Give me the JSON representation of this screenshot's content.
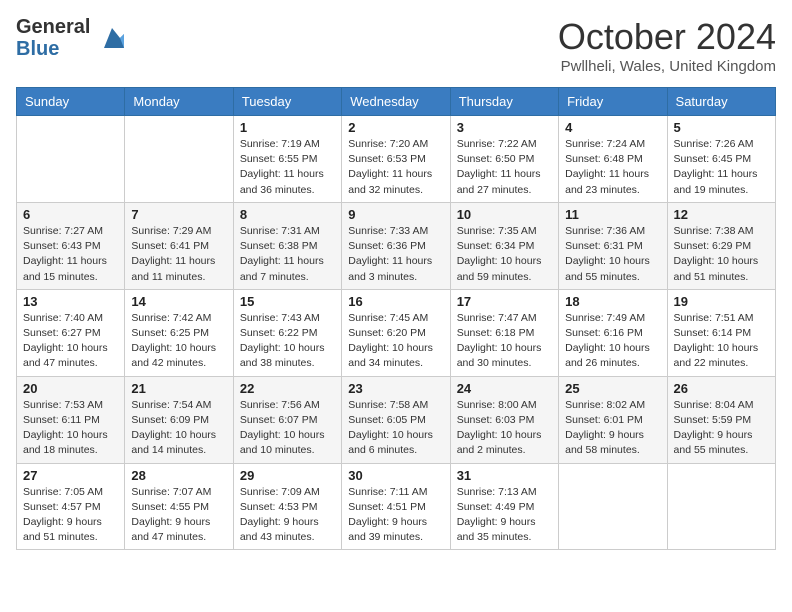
{
  "header": {
    "logo_line1": "General",
    "logo_line2": "Blue",
    "month": "October 2024",
    "location": "Pwllheli, Wales, United Kingdom"
  },
  "days_of_week": [
    "Sunday",
    "Monday",
    "Tuesday",
    "Wednesday",
    "Thursday",
    "Friday",
    "Saturday"
  ],
  "weeks": [
    [
      {
        "day": "",
        "sunrise": "",
        "sunset": "",
        "daylight": ""
      },
      {
        "day": "",
        "sunrise": "",
        "sunset": "",
        "daylight": ""
      },
      {
        "day": "1",
        "sunrise": "Sunrise: 7:19 AM",
        "sunset": "Sunset: 6:55 PM",
        "daylight": "Daylight: 11 hours and 36 minutes."
      },
      {
        "day": "2",
        "sunrise": "Sunrise: 7:20 AM",
        "sunset": "Sunset: 6:53 PM",
        "daylight": "Daylight: 11 hours and 32 minutes."
      },
      {
        "day": "3",
        "sunrise": "Sunrise: 7:22 AM",
        "sunset": "Sunset: 6:50 PM",
        "daylight": "Daylight: 11 hours and 27 minutes."
      },
      {
        "day": "4",
        "sunrise": "Sunrise: 7:24 AM",
        "sunset": "Sunset: 6:48 PM",
        "daylight": "Daylight: 11 hours and 23 minutes."
      },
      {
        "day": "5",
        "sunrise": "Sunrise: 7:26 AM",
        "sunset": "Sunset: 6:45 PM",
        "daylight": "Daylight: 11 hours and 19 minutes."
      }
    ],
    [
      {
        "day": "6",
        "sunrise": "Sunrise: 7:27 AM",
        "sunset": "Sunset: 6:43 PM",
        "daylight": "Daylight: 11 hours and 15 minutes."
      },
      {
        "day": "7",
        "sunrise": "Sunrise: 7:29 AM",
        "sunset": "Sunset: 6:41 PM",
        "daylight": "Daylight: 11 hours and 11 minutes."
      },
      {
        "day": "8",
        "sunrise": "Sunrise: 7:31 AM",
        "sunset": "Sunset: 6:38 PM",
        "daylight": "Daylight: 11 hours and 7 minutes."
      },
      {
        "day": "9",
        "sunrise": "Sunrise: 7:33 AM",
        "sunset": "Sunset: 6:36 PM",
        "daylight": "Daylight: 11 hours and 3 minutes."
      },
      {
        "day": "10",
        "sunrise": "Sunrise: 7:35 AM",
        "sunset": "Sunset: 6:34 PM",
        "daylight": "Daylight: 10 hours and 59 minutes."
      },
      {
        "day": "11",
        "sunrise": "Sunrise: 7:36 AM",
        "sunset": "Sunset: 6:31 PM",
        "daylight": "Daylight: 10 hours and 55 minutes."
      },
      {
        "day": "12",
        "sunrise": "Sunrise: 7:38 AM",
        "sunset": "Sunset: 6:29 PM",
        "daylight": "Daylight: 10 hours and 51 minutes."
      }
    ],
    [
      {
        "day": "13",
        "sunrise": "Sunrise: 7:40 AM",
        "sunset": "Sunset: 6:27 PM",
        "daylight": "Daylight: 10 hours and 47 minutes."
      },
      {
        "day": "14",
        "sunrise": "Sunrise: 7:42 AM",
        "sunset": "Sunset: 6:25 PM",
        "daylight": "Daylight: 10 hours and 42 minutes."
      },
      {
        "day": "15",
        "sunrise": "Sunrise: 7:43 AM",
        "sunset": "Sunset: 6:22 PM",
        "daylight": "Daylight: 10 hours and 38 minutes."
      },
      {
        "day": "16",
        "sunrise": "Sunrise: 7:45 AM",
        "sunset": "Sunset: 6:20 PM",
        "daylight": "Daylight: 10 hours and 34 minutes."
      },
      {
        "day": "17",
        "sunrise": "Sunrise: 7:47 AM",
        "sunset": "Sunset: 6:18 PM",
        "daylight": "Daylight: 10 hours and 30 minutes."
      },
      {
        "day": "18",
        "sunrise": "Sunrise: 7:49 AM",
        "sunset": "Sunset: 6:16 PM",
        "daylight": "Daylight: 10 hours and 26 minutes."
      },
      {
        "day": "19",
        "sunrise": "Sunrise: 7:51 AM",
        "sunset": "Sunset: 6:14 PM",
        "daylight": "Daylight: 10 hours and 22 minutes."
      }
    ],
    [
      {
        "day": "20",
        "sunrise": "Sunrise: 7:53 AM",
        "sunset": "Sunset: 6:11 PM",
        "daylight": "Daylight: 10 hours and 18 minutes."
      },
      {
        "day": "21",
        "sunrise": "Sunrise: 7:54 AM",
        "sunset": "Sunset: 6:09 PM",
        "daylight": "Daylight: 10 hours and 14 minutes."
      },
      {
        "day": "22",
        "sunrise": "Sunrise: 7:56 AM",
        "sunset": "Sunset: 6:07 PM",
        "daylight": "Daylight: 10 hours and 10 minutes."
      },
      {
        "day": "23",
        "sunrise": "Sunrise: 7:58 AM",
        "sunset": "Sunset: 6:05 PM",
        "daylight": "Daylight: 10 hours and 6 minutes."
      },
      {
        "day": "24",
        "sunrise": "Sunrise: 8:00 AM",
        "sunset": "Sunset: 6:03 PM",
        "daylight": "Daylight: 10 hours and 2 minutes."
      },
      {
        "day": "25",
        "sunrise": "Sunrise: 8:02 AM",
        "sunset": "Sunset: 6:01 PM",
        "daylight": "Daylight: 9 hours and 58 minutes."
      },
      {
        "day": "26",
        "sunrise": "Sunrise: 8:04 AM",
        "sunset": "Sunset: 5:59 PM",
        "daylight": "Daylight: 9 hours and 55 minutes."
      }
    ],
    [
      {
        "day": "27",
        "sunrise": "Sunrise: 7:05 AM",
        "sunset": "Sunset: 4:57 PM",
        "daylight": "Daylight: 9 hours and 51 minutes."
      },
      {
        "day": "28",
        "sunrise": "Sunrise: 7:07 AM",
        "sunset": "Sunset: 4:55 PM",
        "daylight": "Daylight: 9 hours and 47 minutes."
      },
      {
        "day": "29",
        "sunrise": "Sunrise: 7:09 AM",
        "sunset": "Sunset: 4:53 PM",
        "daylight": "Daylight: 9 hours and 43 minutes."
      },
      {
        "day": "30",
        "sunrise": "Sunrise: 7:11 AM",
        "sunset": "Sunset: 4:51 PM",
        "daylight": "Daylight: 9 hours and 39 minutes."
      },
      {
        "day": "31",
        "sunrise": "Sunrise: 7:13 AM",
        "sunset": "Sunset: 4:49 PM",
        "daylight": "Daylight: 9 hours and 35 minutes."
      },
      {
        "day": "",
        "sunrise": "",
        "sunset": "",
        "daylight": ""
      },
      {
        "day": "",
        "sunrise": "",
        "sunset": "",
        "daylight": ""
      }
    ]
  ]
}
